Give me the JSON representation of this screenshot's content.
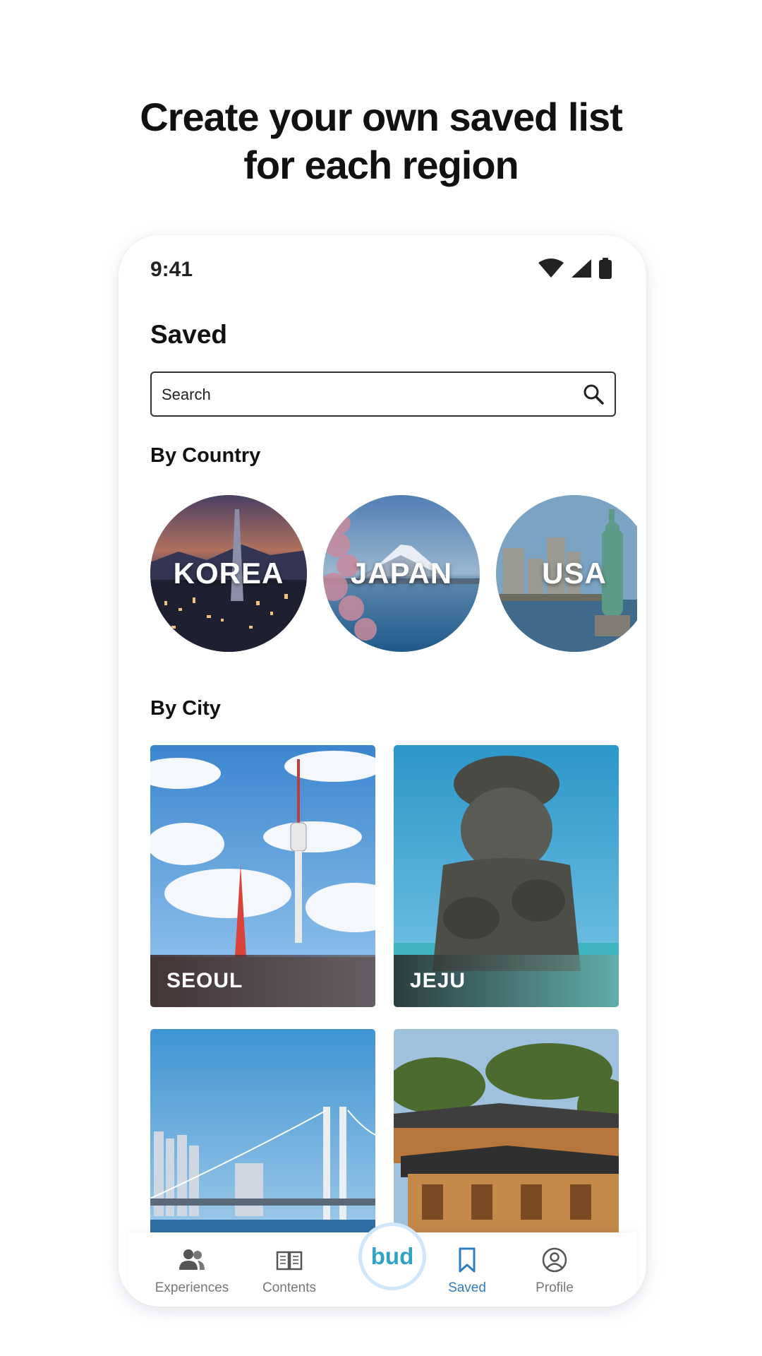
{
  "headline": {
    "line1": "Create your own saved list",
    "line2": "for each region"
  },
  "status": {
    "time": "9:41"
  },
  "screen": {
    "title": "Saved",
    "search": {
      "placeholder": "Search"
    },
    "by_country_label": "By Country",
    "countries": [
      {
        "label": "KOREA"
      },
      {
        "label": "JAPAN"
      },
      {
        "label": "USA"
      }
    ],
    "by_city_label": "By City",
    "cities": [
      {
        "label": "SEOUL"
      },
      {
        "label": "JEJU"
      },
      {
        "label": ""
      },
      {
        "label": ""
      }
    ]
  },
  "tabbar": {
    "items": [
      {
        "label": "Experiences",
        "icon": "people-icon"
      },
      {
        "label": "Contents",
        "icon": "book-icon"
      },
      {
        "label": "bud",
        "icon": "bud-logo"
      },
      {
        "label": "Saved",
        "icon": "bookmark-icon"
      },
      {
        "label": "Profile",
        "icon": "profile-icon"
      }
    ],
    "active": "Saved"
  },
  "colors": {
    "accent": "#2f7cc0",
    "brand": "#2fa3c7",
    "ring": "#cfe6fb"
  }
}
